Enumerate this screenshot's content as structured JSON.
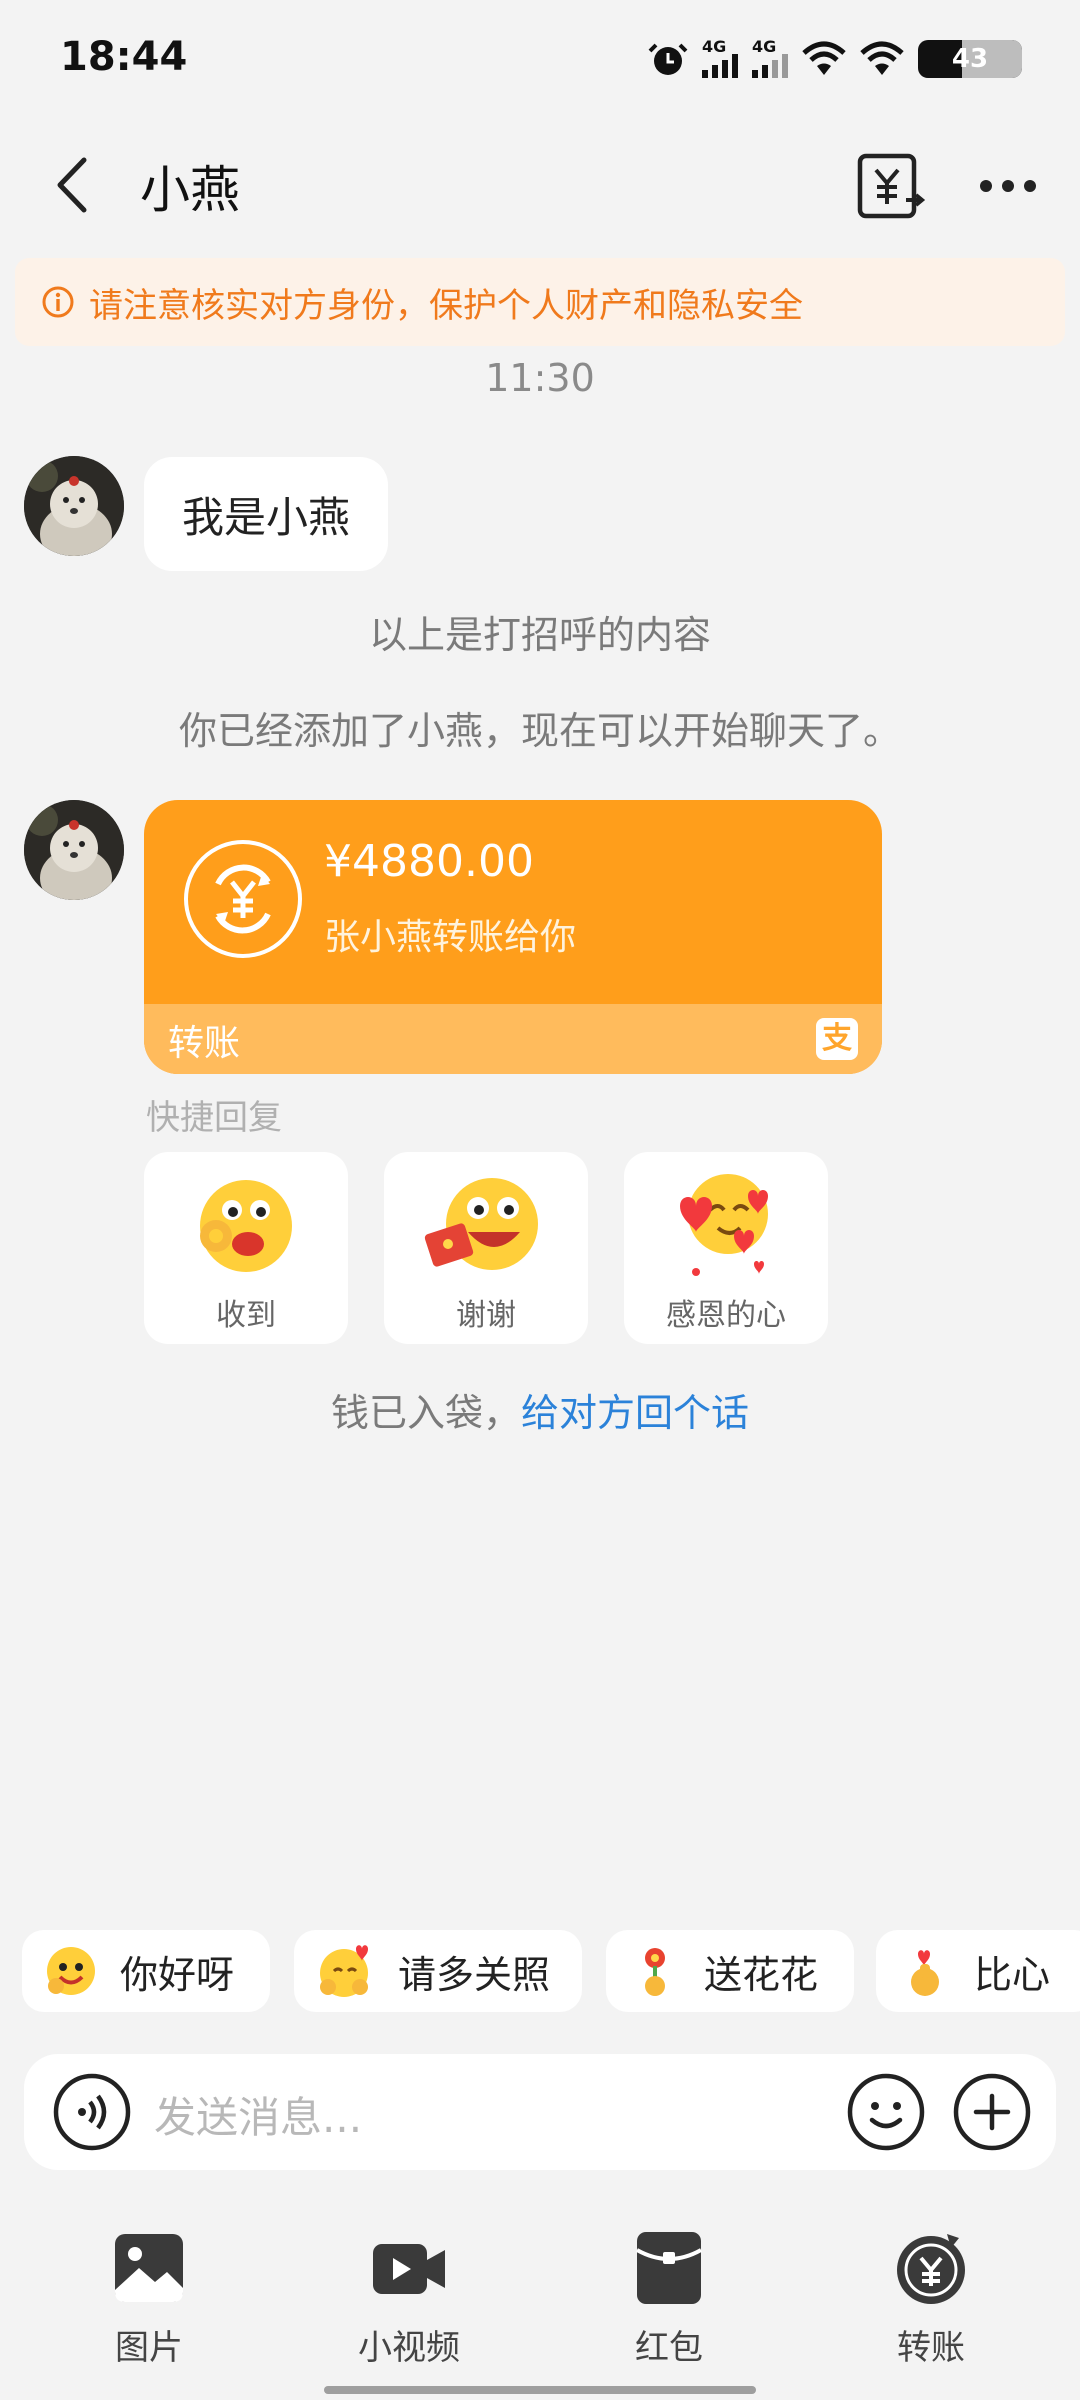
{
  "status_bar": {
    "time": "18:44",
    "network_1": "4G",
    "network_2": "4G",
    "battery": "43"
  },
  "header": {
    "title": "小燕"
  },
  "warning": {
    "text": "请注意核实对方身份，保护个人财产和隐私安全"
  },
  "chat": {
    "timestamp": "11:30",
    "greeting_message": "我是小燕",
    "system_note_1": "以上是打招呼的内容",
    "system_note_2": "你已经添加了小燕，现在可以开始聊天了。",
    "transfer": {
      "amount": "¥4880.00",
      "description": "张小燕转账给你",
      "footer_label": "转账",
      "alipay_glyph": "支"
    },
    "quick_reply_label": "快捷回复",
    "quick_replies": [
      {
        "label": "收到"
      },
      {
        "label": "谢谢"
      },
      {
        "label": "感恩的心"
      }
    ],
    "received_note": "钱已入袋，",
    "received_link": "给对方回个话"
  },
  "suggestion_chips": [
    {
      "label": "你好呀"
    },
    {
      "label": "请多关照"
    },
    {
      "label": "送花花"
    },
    {
      "label": "比心"
    }
  ],
  "input": {
    "placeholder": "发送消息..."
  },
  "toolbar": [
    {
      "label": "图片"
    },
    {
      "label": "小视频"
    },
    {
      "label": "红包"
    },
    {
      "label": "转账"
    }
  ],
  "colors": {
    "accent_orange": "#ff9e1b",
    "warning_text": "#f07a1c",
    "link_blue": "#2b82d9"
  }
}
